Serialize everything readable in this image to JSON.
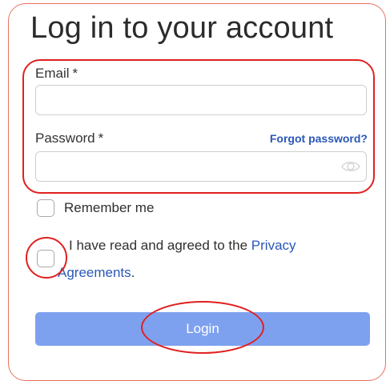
{
  "form": {
    "title": "Log in to your account",
    "email_label": "Email",
    "email_required": "*",
    "email_value": "",
    "password_label": "Password",
    "password_required": "*",
    "password_value": "",
    "forgot_link": "Forgot password?",
    "eye_icon": "eye-icon",
    "remember_label": "Remember me",
    "agree_text": "I have read and agreed to the ",
    "agree_link": "Privacy Agreements",
    "agree_end": ".",
    "login_label": "Login"
  },
  "colors": {
    "accent_link": "#2a57b8",
    "button_bg": "#7ea1ef",
    "annotation_red": "#e02020",
    "card_border": "#e8705f"
  }
}
